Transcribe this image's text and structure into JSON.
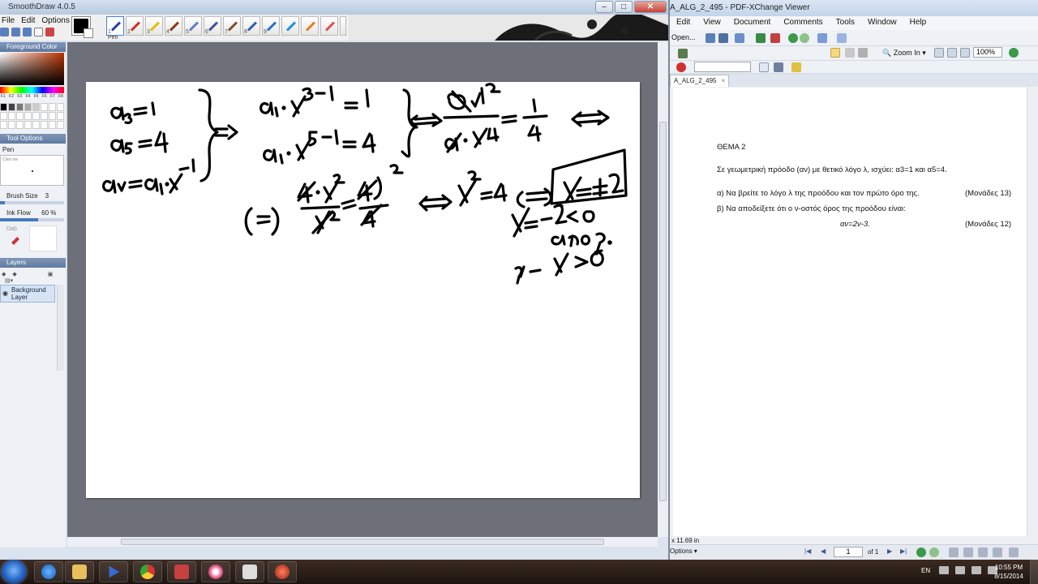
{
  "smoothdraw": {
    "title": "SmoothDraw 4.0.5",
    "menu": [
      "File",
      "Edit",
      "Options"
    ],
    "tools": [
      {
        "num": "1",
        "color": "#2a3bb0"
      },
      {
        "num": "2",
        "color": "#d03020"
      },
      {
        "num": "3",
        "color": "#e0c000"
      },
      {
        "num": "4",
        "color": "#8b3a10"
      },
      {
        "num": "5",
        "color": "#6080c0"
      },
      {
        "num": "6",
        "color": "#4050a0"
      },
      {
        "num": "7",
        "color": "#80502a"
      },
      {
        "num": "8",
        "color": "#3060b0"
      },
      {
        "num": "9",
        "color": "#2a70d0"
      },
      {
        "num": "",
        "color": "#1d8fe0"
      },
      {
        "num": "",
        "color": "#e08020"
      },
      {
        "num": "",
        "color": "#e05050"
      }
    ],
    "selected_tool_label": "Pen",
    "foreground_color_header": "Foreground Color",
    "fkeys": [
      "F1",
      "F2",
      "F3",
      "F4",
      "F5",
      "F6",
      "F7",
      "F8"
    ],
    "tool_options_header": "Tool Options",
    "tool_name": "Pen",
    "curve_label": "Click me",
    "brush_size_label": "Brush Size",
    "brush_size_value": "3",
    "brush_size_fraction": 0.08,
    "ink_flow_label": "Ink Flow",
    "ink_flow_value": "60 %",
    "ink_flow_fraction": 0.6,
    "dab_label": "Dab",
    "layers_header": "Layers",
    "layer_name": "Background Layer",
    "ink_color": "#000000"
  },
  "pdf": {
    "title": "A_ALG_2_495 - PDF-XChange Viewer",
    "menu": [
      "Edit",
      "View",
      "Document",
      "Comments",
      "Tools",
      "Window",
      "Help"
    ],
    "open_label": "Open...",
    "zoom_in_label": "Zoom In",
    "zoom_value": "100%",
    "tab_label": "A_ALG_2_495",
    "document": {
      "heading": "ΘΕΜΑ 2",
      "intro": "Σε γεωμετρική πρόοδο (αν) με θετικό λόγο λ, ισχύει:  α3=1 και α5=4.",
      "q_a": "α) Να βρείτε το λόγο λ της προόδου και τον πρώτο όρο της.",
      "q_a_points": "(Μονάδες 13)",
      "q_b": "β) Να αποδείξετε ότι ο ν-οστός όρος της προόδου είναι:",
      "formula": "αν=2ν-3.",
      "q_b_points": "(Μονάδες 12)"
    },
    "status": {
      "size": "x 11.69 in",
      "options_label": "Options",
      "page_current": "1",
      "page_total": "of 1"
    }
  },
  "taskbar": {
    "language": "EN",
    "time": "10:55 PM",
    "date": "8/15/2014"
  }
}
